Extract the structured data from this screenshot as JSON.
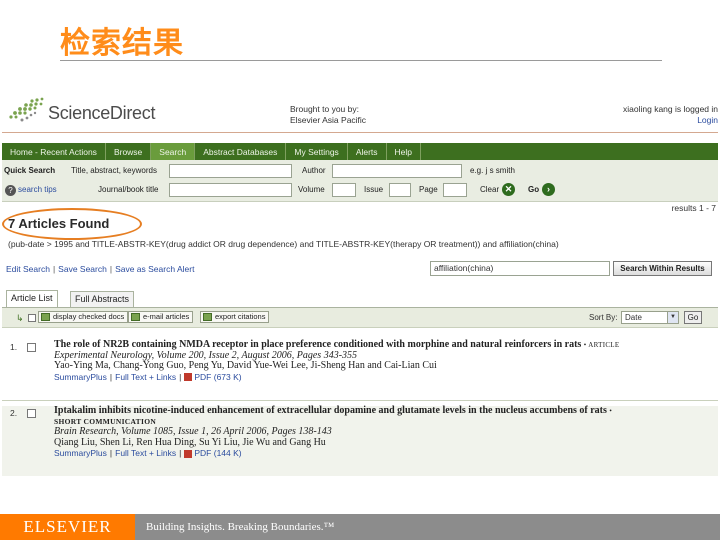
{
  "slide": {
    "title": "检索结果"
  },
  "header": {
    "logo_text": "ScienceDirect",
    "brought_line1": "Brought to you by:",
    "brought_line2": "Elsevier Asia Pacific",
    "user_line": "xiaoling kang is logged in",
    "user_link": "Login"
  },
  "nav": {
    "items": [
      {
        "label": "Home - Recent Actions",
        "active": false
      },
      {
        "label": "Browse",
        "active": false
      },
      {
        "label": "Search",
        "active": true
      },
      {
        "label": "Abstract Databases",
        "active": false
      },
      {
        "label": "My Settings",
        "active": false
      },
      {
        "label": "Alerts",
        "active": false
      },
      {
        "label": "Help",
        "active": false
      }
    ]
  },
  "quick_search": {
    "label": "Quick Search",
    "field1_label": "Title, abstract, keywords",
    "field1_value": "",
    "author_label": "Author",
    "author_value": "",
    "author_example": "e.g. j s smith",
    "search_tips": "search tips",
    "journal_label": "Journal/book title",
    "journal_value": "",
    "volume_label": "Volume",
    "issue_label": "Issue",
    "page_label": "Page",
    "clear_label": "Clear",
    "go_label": "Go"
  },
  "results": {
    "found_text": "7 Articles Found",
    "count_text": "results 1 - 7",
    "query_text": "(pub-date > 1995 and TITLE-ABSTR-KEY(drug addict OR drug dependence) and TITLE-ABSTR-KEY(therapy OR treatment)) and affiliation(china)",
    "actions": [
      "Edit Search",
      "Save Search",
      "Save as Search Alert"
    ],
    "within_input_value": "affiliation(china)",
    "within_button": "Search Within Results",
    "tabs": [
      "Article List",
      "Full Abstracts"
    ],
    "toolbar": {
      "display_checked": "display checked docs",
      "email_articles": "e-mail articles",
      "export_citations": "export citations",
      "sort_label": "Sort By:",
      "sort_value": "Date",
      "sort_go": "Go"
    },
    "items": [
      {
        "num": "1.",
        "title": "The role of NR2B containing NMDA receptor in place preference conditioned with morphine and natural reinforcers in rats",
        "doctype": "• ARTICLE",
        "type_line": "",
        "source": "Experimental Neurology, Volume 200, Issue 2, August 2006, Pages 343-355",
        "authors": "Yao-Ying Ma, Chang-Yong Guo, Peng Yu, David Yue-Wei Lee, Ji-Sheng Han and Cai-Lian Cui",
        "links": [
          "SummaryPlus",
          "Full Text + Links",
          "PDF (673 K)"
        ]
      },
      {
        "num": "2.",
        "title": "Iptakalim inhibits nicotine-induced enhancement of extracellular dopamine and glutamate levels in the nucleus accumbens of rats",
        "doctype": "•",
        "type_line": "SHORT COMMUNICATION",
        "source": "Brain Research, Volume 1085, Issue 1, 26 April 2006, Pages 138-143",
        "authors": "Qiang Liu, Shen Li, Ren Hua Ding, Su Yi Liu, Jie Wu and Gang Hu",
        "links": [
          "SummaryPlus",
          "Full Text + Links",
          "PDF (144 K)"
        ]
      }
    ]
  },
  "footer": {
    "brand": "ELSEVIER",
    "tagline": "Building Insights. Breaking Boundaries.™"
  },
  "colors": {
    "title_orange": "#ff8c1a",
    "nav_green": "#3d6f1f",
    "nav_active": "#6a9c3c",
    "highlight_oval": "#e67e22",
    "link_blue": "#2b4c9e",
    "footer_gray": "#8c8c8c",
    "footer_orange": "#ff7a00"
  }
}
